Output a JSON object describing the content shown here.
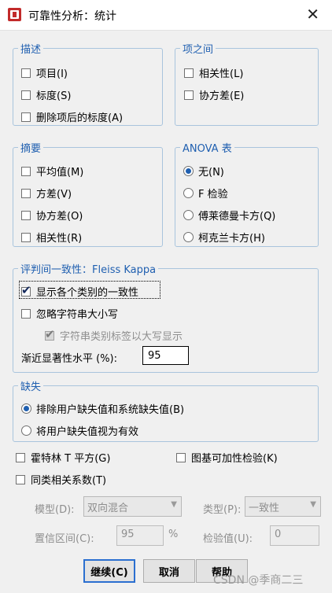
{
  "window": {
    "title": "可靠性分析：统计",
    "close_symbol": "✕"
  },
  "descriptives": {
    "legend": "描述",
    "items": [
      {
        "label": "项目(I)",
        "checked": false
      },
      {
        "label": "标度(S)",
        "checked": false
      },
      {
        "label": "删除项后的标度(A)",
        "checked": false
      }
    ]
  },
  "inter_item": {
    "legend": "项之间",
    "items": [
      {
        "label": "相关性(L)",
        "checked": false
      },
      {
        "label": "协方差(E)",
        "checked": false
      }
    ]
  },
  "summaries": {
    "legend": "摘要",
    "items": [
      {
        "label": "平均值(M)",
        "checked": false
      },
      {
        "label": "方差(V)",
        "checked": false
      },
      {
        "label": "协方差(O)",
        "checked": false
      },
      {
        "label": "相关性(R)",
        "checked": false
      }
    ]
  },
  "anova": {
    "legend": "ANOVA 表",
    "options": [
      {
        "label": "无(N)",
        "selected": true
      },
      {
        "label": "F 检验",
        "selected": false
      },
      {
        "label": "傅莱德曼卡方(Q)",
        "selected": false
      },
      {
        "label": "柯克兰卡方(H)",
        "selected": false
      }
    ]
  },
  "fleiss": {
    "legend": "评判间一致性：Fleiss Kappa",
    "show_agreement": {
      "label": "显示各个类别的一致性",
      "checked": true
    },
    "ignore_case": {
      "label": "忽略字符串大小写",
      "checked": false
    },
    "uppercase_labels": {
      "label": "字符串类别标签以大写显示",
      "checked": true
    },
    "significance_label": "渐近显著性水平 (%):",
    "significance_value": "95"
  },
  "missing": {
    "legend": "缺失",
    "options": [
      {
        "label": "排除用户缺失值和系统缺失值(B)",
        "selected": true
      },
      {
        "label": "将用户缺失值视为有效",
        "selected": false
      }
    ]
  },
  "extra": {
    "hotelling": {
      "label": "霍特林 T 平方(G)",
      "checked": false
    },
    "tukey": {
      "label": "图基可加性检验(K)",
      "checked": false
    },
    "icc": {
      "label": "同类相关系数(T)",
      "checked": false
    }
  },
  "icc_settings": {
    "model_label": "模型(D):",
    "model_value": "双向混合",
    "type_label": "类型(P):",
    "type_value": "一致性",
    "ci_label": "置信区间(C):",
    "ci_value": "95",
    "ci_unit": "%",
    "test_label": "检验值(U):",
    "test_value": "0"
  },
  "buttons": {
    "continue": "继续(C)",
    "cancel": "取消",
    "help": "帮助"
  },
  "watermark": "CSDN @季商二三",
  "colors": {
    "legend_blue": "#1f5fb0",
    "group_border": "#a9c4dd",
    "default_button_border": "#2b6fd0"
  }
}
